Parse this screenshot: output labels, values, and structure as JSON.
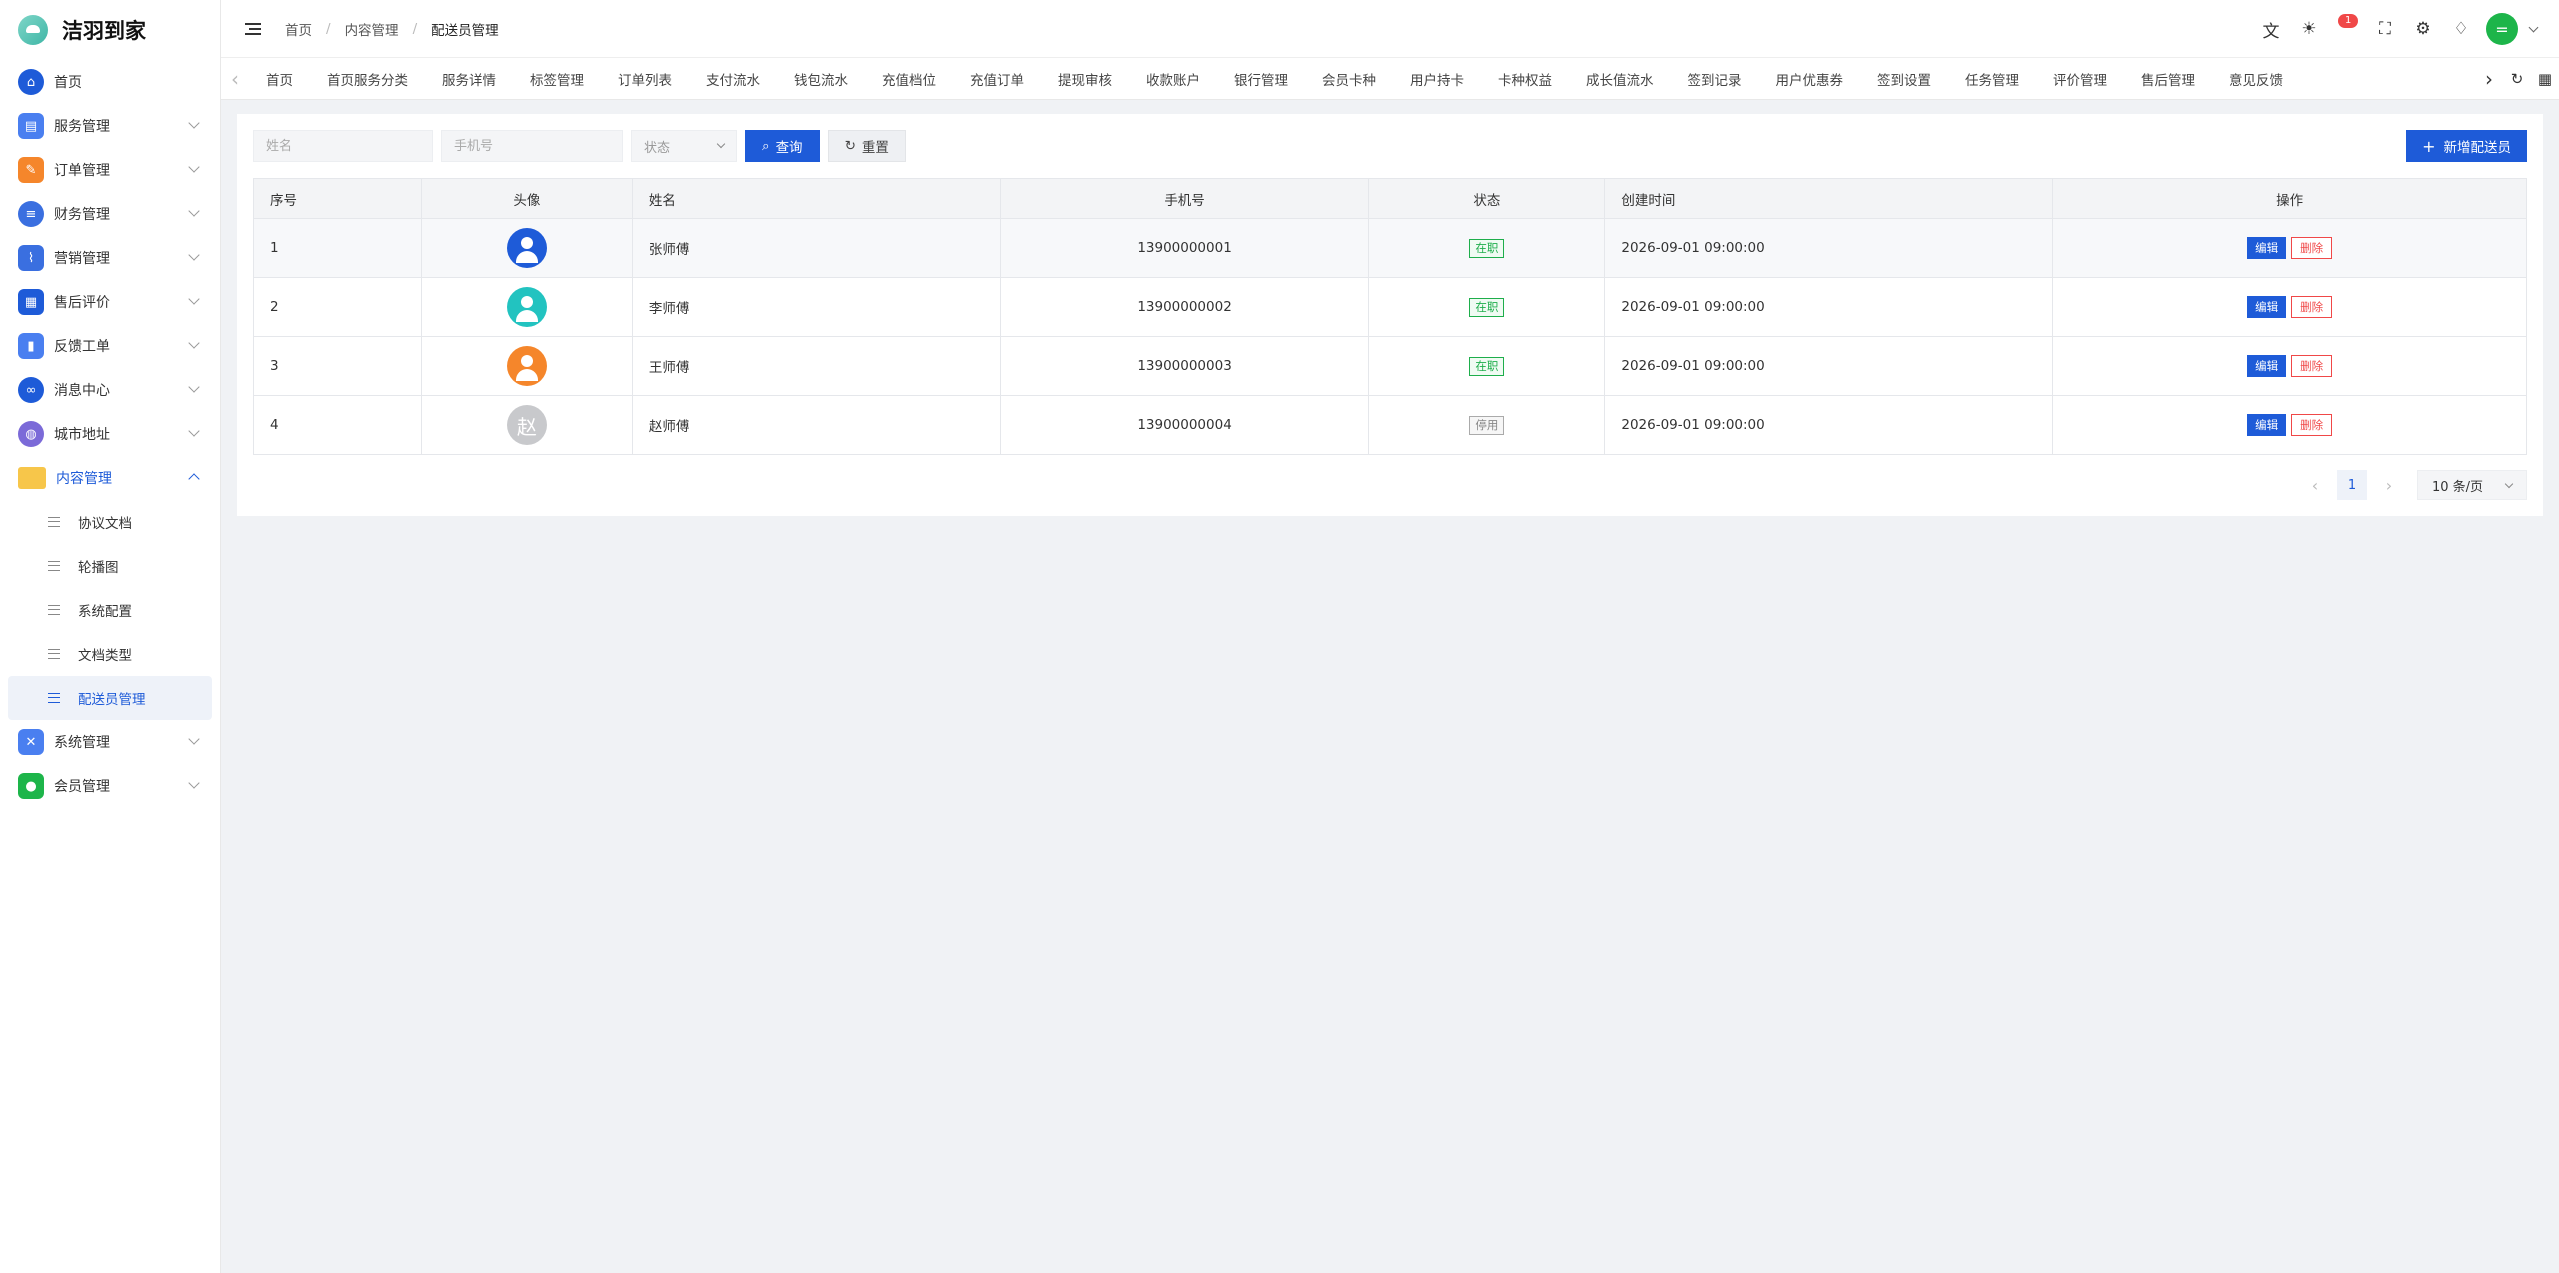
{
  "app": {
    "title": "洁羽到家"
  },
  "sidebar": {
    "items": [
      {
        "label": "首页",
        "icon": "home-icon",
        "color": "#1e5bd8"
      },
      {
        "label": "服务管理",
        "icon": "clipboard-icon",
        "color": "#4a7ff0"
      },
      {
        "label": "订单管理",
        "icon": "order-icon",
        "color": "#f5862b"
      },
      {
        "label": "财务管理",
        "icon": "document-icon",
        "color": "#3a6fe0"
      },
      {
        "label": "营销管理",
        "icon": "chart-icon",
        "color": "#3a6fe0"
      },
      {
        "label": "售后评价",
        "icon": "grid-icon",
        "color": "#1e5bd8"
      },
      {
        "label": "反馈工单",
        "icon": "file-icon",
        "color": "#4a7ff0"
      },
      {
        "label": "消息中心",
        "icon": "link-icon",
        "color": "#1e5bd8"
      },
      {
        "label": "城市地址",
        "icon": "planet-icon",
        "color": "#7b6ad8"
      },
      {
        "label": "内容管理",
        "icon": "folder-icon",
        "color": "#f7c64a"
      },
      {
        "label": "系统管理",
        "icon": "tools-icon",
        "color": "#4a7ff0"
      },
      {
        "label": "会员管理",
        "icon": "user-icon",
        "color": "#1db54a"
      }
    ],
    "sub": [
      "协议文档",
      "轮播图",
      "系统配置",
      "文档类型",
      "配送员管理"
    ]
  },
  "header": {
    "crumbs": [
      "首页",
      "内容管理",
      "配送员管理"
    ],
    "badge": "1",
    "avatar_char": "="
  },
  "tabs": [
    "首页",
    "首页服务分类",
    "服务详情",
    "标签管理",
    "订单列表",
    "支付流水",
    "钱包流水",
    "充值档位",
    "充值订单",
    "提现审核",
    "收款账户",
    "银行管理",
    "会员卡种",
    "用户持卡",
    "卡种权益",
    "成长值流水",
    "签到记录",
    "用户优惠券",
    "签到设置",
    "任务管理",
    "评价管理",
    "售后管理",
    "意见反馈"
  ],
  "filters": {
    "name_placeholder": "姓名",
    "phone_placeholder": "手机号",
    "status_placeholder": "状态",
    "search_label": "查询",
    "reset_label": "重置",
    "add_label": "新增配送员"
  },
  "table": {
    "columns": [
      "序号",
      "头像",
      "姓名",
      "手机号",
      "状态",
      "创建时间",
      "操作"
    ],
    "rows": [
      {
        "no": "1",
        "name": "张师傅",
        "phone": "13900000001",
        "status": "在职",
        "created": "2026-09-01 09:00:00"
      },
      {
        "no": "2",
        "name": "李师傅",
        "phone": "13900000002",
        "status": "在职",
        "created": "2026-09-01 09:00:00"
      },
      {
        "no": "3",
        "name": "王师傅",
        "phone": "13900000003",
        "status": "在职",
        "created": "2026-09-01 09:00:00"
      },
      {
        "no": "4",
        "name": "赵师傅",
        "phone": "13900000004",
        "status": "停用",
        "created": "2026-09-01 09:00:00",
        "avatar_char": "赵"
      }
    ],
    "edit_label": "编辑",
    "delete_label": "删除"
  },
  "pager": {
    "page": "1",
    "size": "10 条/页"
  }
}
